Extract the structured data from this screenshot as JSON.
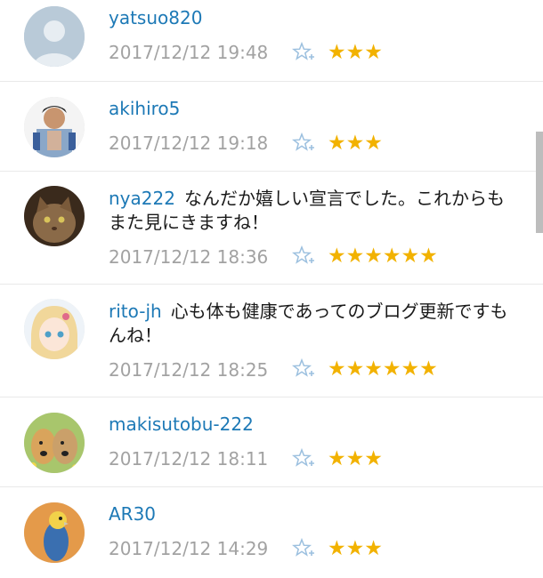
{
  "comments": [
    {
      "user": "yatsuo820",
      "text": "",
      "time": "2017/12/12 19:48",
      "stars": "★★★"
    },
    {
      "user": "akihiro5",
      "text": "",
      "time": "2017/12/12 19:18",
      "stars": "★★★"
    },
    {
      "user": "nya222",
      "text": "なんだか嬉しい宣言でした。これからもまた見にきますね！",
      "time": "2017/12/12 18:36",
      "stars": "★★★★★★"
    },
    {
      "user": "rito-jh",
      "text": "心も体も健康であってのブログ更新ですもんね！",
      "time": "2017/12/12 18:25",
      "stars": "★★★★★★"
    },
    {
      "user": "makisutobu-222",
      "text": "",
      "time": "2017/12/12 18:11",
      "stars": "★★★"
    },
    {
      "user": "AR30",
      "text": "",
      "time": "2017/12/12 14:29",
      "stars": "★★★"
    }
  ],
  "icons": {
    "add_star": "add-star-icon",
    "star": "star-icon"
  },
  "colors": {
    "username": "#1d79b6",
    "star": "#f2b200",
    "timestamp": "#a2a2a2"
  }
}
